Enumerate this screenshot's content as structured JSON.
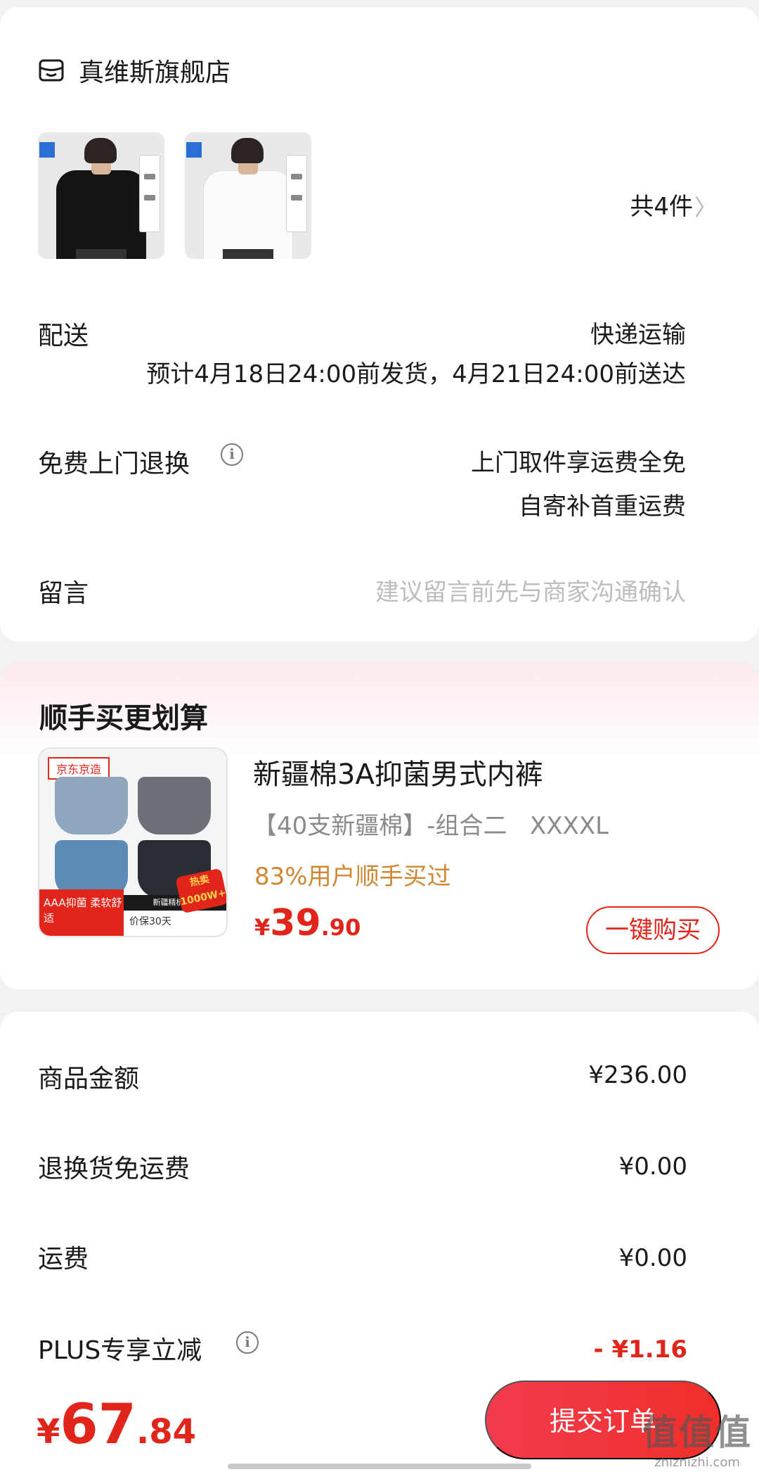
{
  "store": {
    "name": "真维斯旗舰店",
    "item_count": "共4件"
  },
  "delivery": {
    "label": "配送",
    "method": "快递运输",
    "estimate": "预计4月18日24:00前发货，4月21日24:00前送达"
  },
  "returns": {
    "label": "免费上门退换",
    "line1": "上门取件享运费全免",
    "line2": "自寄补首重运费"
  },
  "message": {
    "label": "留言",
    "placeholder": "建议留言前先与商家沟通确认"
  },
  "recommend": {
    "title": "顺手买更划算",
    "product_name": "新疆棉3A抑菌男式内裤",
    "spec": "【40支新疆棉】-组合二   XXXXL",
    "bought": "83%用户顺手买过",
    "price_currency": "¥",
    "price_int": "39",
    "price_dec": ".90",
    "button": "一键购买",
    "image_texts": {
      "brand_tag": "京东京造",
      "band_left": "AAA抑菌 柔软舒适",
      "band_price": "价保30天",
      "band_mid": "新疆精梳棉",
      "hot": "热卖 1000W+"
    }
  },
  "amounts": [
    {
      "label": "商品金额",
      "value": "¥236.00"
    },
    {
      "label": "退换货免运费",
      "value": "¥0.00"
    },
    {
      "label": "运费",
      "value": "¥0.00"
    },
    {
      "label": "PLUS专享立减",
      "value": "- ¥1.16"
    }
  ],
  "total": {
    "currency": "¥",
    "int": "67",
    "dec": ".84"
  },
  "submit_button": "提交订单",
  "watermark": {
    "top": "值值值",
    "bottom": "zhizhizhi.com"
  },
  "colors": {
    "accent_red": "#e1251b",
    "bought_orange": "#cf8734"
  }
}
